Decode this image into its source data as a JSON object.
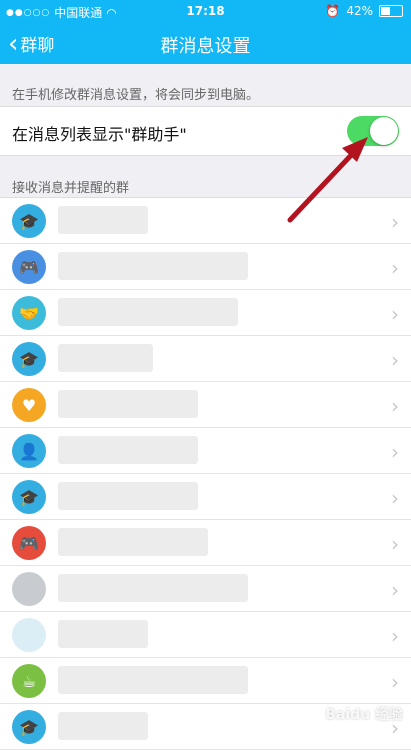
{
  "status": {
    "carrier": "中国联通",
    "time": "17:18",
    "battery": "42%"
  },
  "nav": {
    "back_label": "群聊",
    "title": "群消息设置"
  },
  "hint_text": "在手机修改群消息设置，将会同步到电脑。",
  "toggle_row": {
    "label": "在消息列表显示\"群助手\"",
    "enabled": true
  },
  "section_title": "接收消息并提醒的群",
  "groups": [
    {
      "avatar_icon": "graduation-cap-icon",
      "color": "#34aee0"
    },
    {
      "avatar_icon": "gamepad-icon",
      "color": "#4a90e2"
    },
    {
      "avatar_icon": "handshake-icon",
      "color": "#3dbbdb"
    },
    {
      "avatar_icon": "graduation-cap-icon",
      "color": "#34aee0"
    },
    {
      "avatar_icon": "heart-icon",
      "color": "#f5a623"
    },
    {
      "avatar_icon": "badge-icon",
      "color": "#34aee0"
    },
    {
      "avatar_icon": "graduation-cap-icon",
      "color": "#34aee0"
    },
    {
      "avatar_icon": "gamepad-icon",
      "color": "#e64c3c"
    },
    {
      "avatar_icon": "placeholder-icon",
      "color": "#c8ccd0"
    },
    {
      "avatar_icon": "placeholder-icon",
      "color": "#dbeef6"
    },
    {
      "avatar_icon": "cup-icon",
      "color": "#7bc043"
    },
    {
      "avatar_icon": "graduation-cap-icon",
      "color": "#34aee0"
    }
  ],
  "watermark": "Baidu 经验"
}
